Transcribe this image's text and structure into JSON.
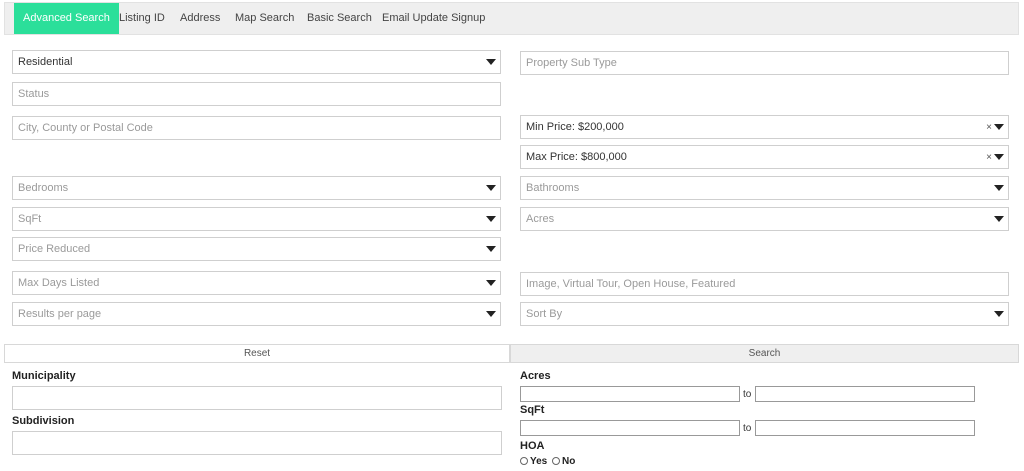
{
  "tabs": [
    {
      "label": "Advanced Search"
    },
    {
      "label": "Listing ID"
    },
    {
      "label": "Address"
    },
    {
      "label": "Map Search"
    },
    {
      "label": "Basic Search"
    },
    {
      "label": "Email Update Signup"
    }
  ],
  "form": {
    "property_type": "Residential",
    "property_sub_type_placeholder": "Property Sub Type",
    "status_placeholder": "Status",
    "location_placeholder": "City, County or Postal Code",
    "min_price": "Min Price: $200,000",
    "max_price": "Max Price: $800,000",
    "clear_glyph": "×",
    "bedrooms": "Bedrooms",
    "bathrooms": "Bathrooms",
    "sqft": "SqFt",
    "acres": "Acres",
    "price_reduced": "Price Reduced",
    "max_days_listed": "Max Days Listed",
    "features_placeholder": "Image, Virtual Tour, Open House, Featured",
    "results_per_page": "Results per page",
    "sort_by": "Sort By"
  },
  "buttons": {
    "reset": "Reset",
    "search": "Search"
  },
  "extra": {
    "municipality": "Municipality",
    "subdivision": "Subdivision",
    "acres": "Acres",
    "sqft": "SqFt",
    "to": "to",
    "hoa": "HOA",
    "yes": "Yes",
    "no": "No"
  },
  "colors": {
    "active_tab": "#2bdf9a",
    "tab_bar": "#efefef"
  }
}
